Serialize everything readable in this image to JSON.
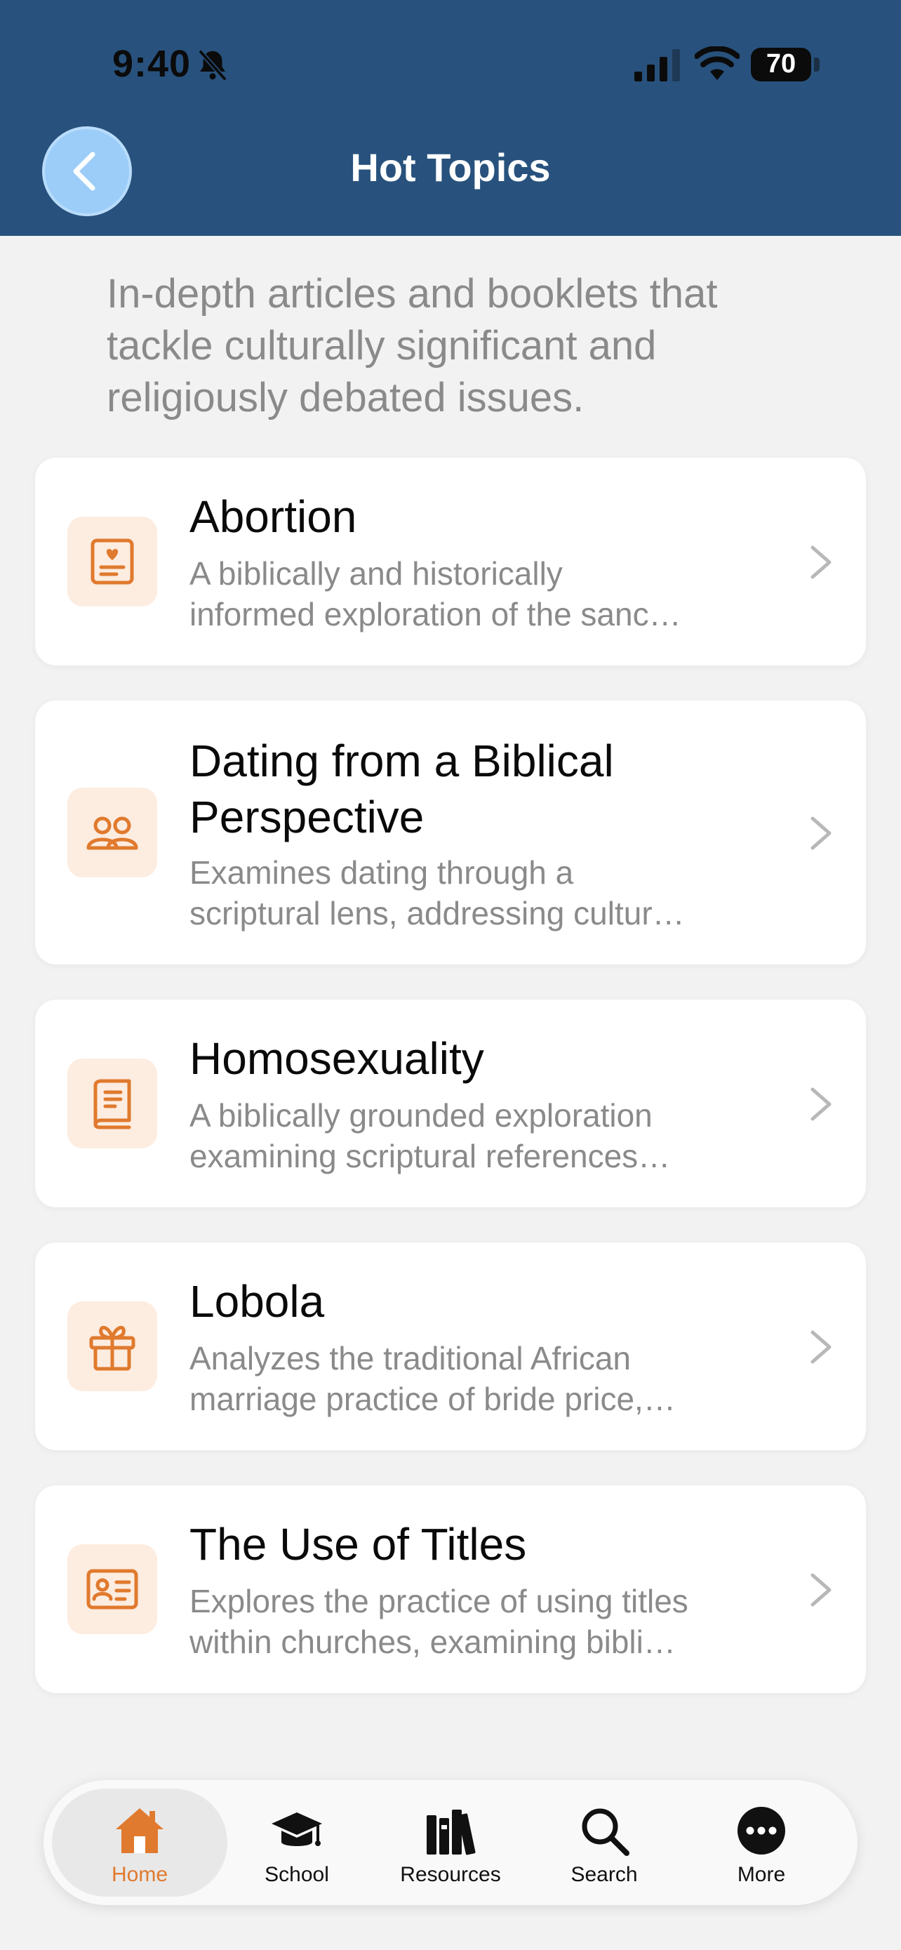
{
  "status_bar": {
    "time": "9:40",
    "battery": "70"
  },
  "header": {
    "title": "Hot Topics"
  },
  "intro": "In-depth articles and booklets that tackle culturally significant and religiously debated issues.",
  "colors": {
    "header_bg": "#28527d",
    "accent": "#e07a2e",
    "icon_bg": "#fdece0",
    "back_button": "#9ccdf9"
  },
  "topics": [
    {
      "icon": "heart-document-icon",
      "title": "Abortion",
      "desc1": "A biblically and historically",
      "desc2": "informed exploration of the sanc…"
    },
    {
      "icon": "people-icon",
      "title": "Dating from a Biblical Perspective",
      "title1": "Dating from a Biblical",
      "title2": "Perspective",
      "desc1": "Examines dating through a",
      "desc2": "scriptural lens, addressing cultur…"
    },
    {
      "icon": "book-icon",
      "title": "Homosexuality",
      "desc1": "A biblically grounded exploration",
      "desc2": "examining scriptural references…"
    },
    {
      "icon": "gift-icon",
      "title": "Lobola",
      "desc1": "Analyzes the traditional African",
      "desc2": "marriage practice of bride price,…"
    },
    {
      "icon": "id-card-icon",
      "title": "The Use of Titles",
      "desc1": "Explores the practice of using titles",
      "desc2": "within churches, examining bibli…"
    }
  ],
  "tabs": [
    {
      "label": "Home",
      "icon": "home-icon",
      "active": true
    },
    {
      "label": "School",
      "icon": "graduation-cap-icon",
      "active": false
    },
    {
      "label": "Resources",
      "icon": "books-icon",
      "active": false
    },
    {
      "label": "Search",
      "icon": "search-icon",
      "active": false
    },
    {
      "label": "More",
      "icon": "more-icon",
      "active": false
    }
  ]
}
